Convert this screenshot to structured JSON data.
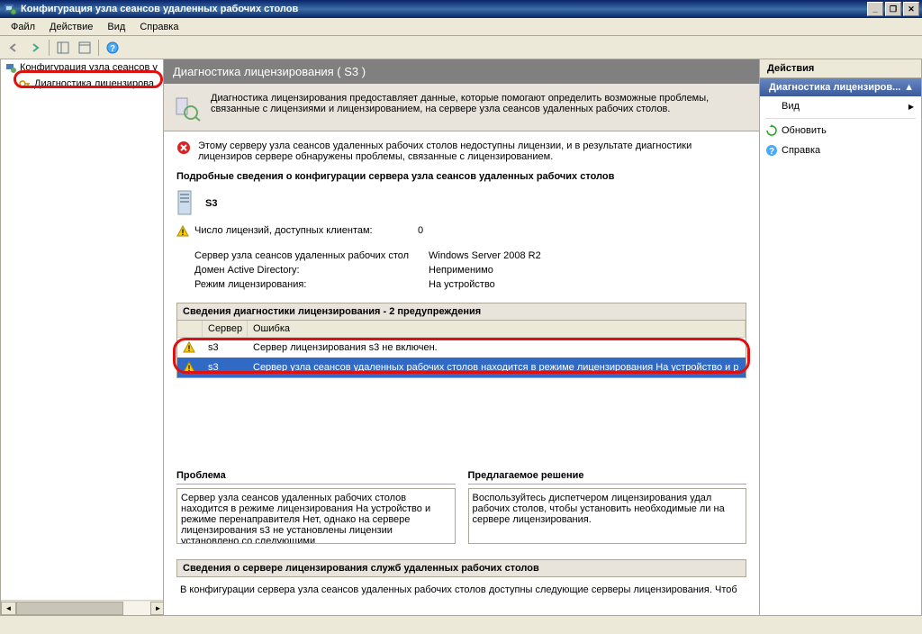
{
  "titlebar": {
    "text": "Конфигурация узла сеансов удаленных рабочих столов"
  },
  "menubar": {
    "file": "Файл",
    "action": "Действие",
    "view": "Вид",
    "help": "Справка"
  },
  "tree": {
    "root": "Конфигурация узла сеансов у",
    "child": "Диагностика лицензирова"
  },
  "content": {
    "header": "Диагностика лицензирования ( S3 )",
    "subheader_text": "Диагностика лицензирования предоставляет данные, которые помогают определить возможные проблемы, связанные с лицензиями и лицензированием, на сервере узла сеансов удаленных рабочих столов.",
    "error_text": "Этому серверу узла сеансов удаленных рабочих столов недоступны лицензии, и в результате диагностики лицензиров сервере обнаружены проблемы, связанные с лицензированием.",
    "section_title": "Подробные сведения о конфигурации сервера узла сеансов удаленных рабочих столов",
    "server_name": "S3",
    "licenses_label": "Число лицензий, доступных клиентам:",
    "licenses_value": "0",
    "kv1_label": "Сервер узла сеансов удаленных рабочих стол",
    "kv1_value": "Windows Server 2008 R2",
    "kv2_label": "Домен Active Directory:",
    "kv2_value": "Неприменимо",
    "kv3_label": "Режим лицензирования:",
    "kv3_value": "На устройство",
    "diag_header": "Сведения диагностики лицензирования - 2 предупреждения",
    "diag_cols": {
      "col2": "Сервер",
      "col3": "Ошибка"
    },
    "diag_rows": [
      {
        "server": "s3",
        "error": "Сервер лицензирования s3 не включен."
      },
      {
        "server": "s3",
        "error": "Сервер узла сеансов удаленных рабочих столов находится в режиме лицензирования На устройство и р"
      }
    ],
    "problem_label": "Проблема",
    "problem_text": "Сервер узла сеансов удаленных рабочих столов находится в режиме лицензирования На устройство и режиме перенаправителя Нет, однако на сервере лицензирования s3 не установлены лицензии установлено со следующими",
    "solution_label": "Предлагаемое решение",
    "solution_text": "Воспользуйтесь диспетчером лицензирования удал рабочих столов, чтобы установить необходимые ли на сервере лицензирования.",
    "bottom_header": "Сведения о сервере лицензирования служб удаленных рабочих столов",
    "bottom_text": "В конфигурации сервера узла сеансов удаленных рабочих столов доступны следующие серверы лицензирования. Чтоб"
  },
  "actions": {
    "header": "Действия",
    "subheader": "Диагностика лицензиров...",
    "view": "Вид",
    "refresh": "Обновить",
    "help": "Справка"
  }
}
